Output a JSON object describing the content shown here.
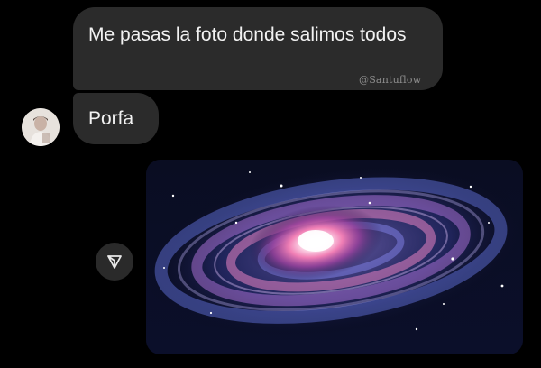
{
  "messages": [
    {
      "text": "Me pasas la foto donde salimos todos"
    },
    {
      "text": "Porfa"
    }
  ],
  "watermark": "@Santuflow",
  "icons": {
    "avatar": "user-avatar",
    "share": "send-icon",
    "image": "galaxy-image"
  },
  "colors": {
    "background": "#000000",
    "bubble": "#2b2b2b",
    "text": "#f2f2f2"
  }
}
